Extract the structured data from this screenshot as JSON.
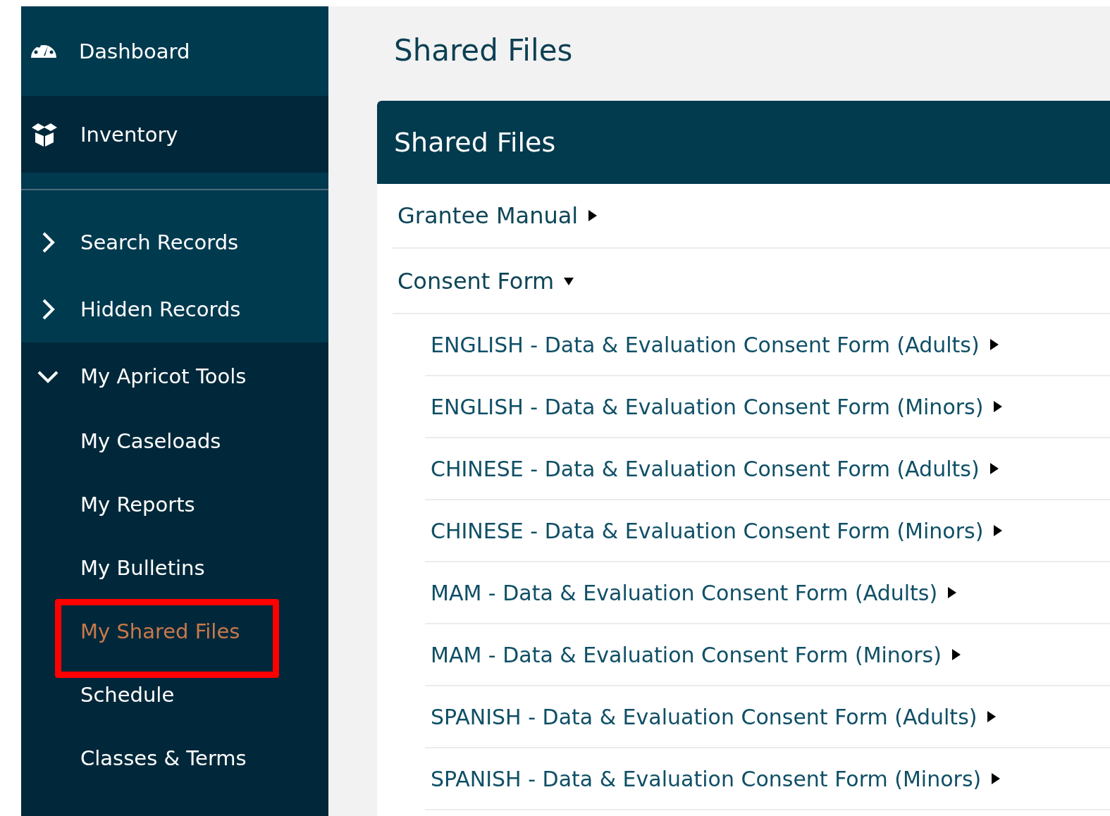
{
  "sidebar": {
    "top_items": [
      {
        "label": "Dashboard",
        "selected": false
      },
      {
        "label": "Inventory",
        "selected": true
      }
    ],
    "groups": [
      {
        "label": "Search Records",
        "expanded": false
      },
      {
        "label": "Hidden Records",
        "expanded": false
      },
      {
        "label": "My Apricot Tools",
        "expanded": true,
        "children": [
          {
            "label": "My Caseloads",
            "selected": false,
            "highlighted": false
          },
          {
            "label": "My Reports",
            "selected": false,
            "highlighted": false
          },
          {
            "label": "My Bulletins",
            "selected": false,
            "highlighted": false
          },
          {
            "label": "My Shared Files",
            "selected": true,
            "highlighted": true
          },
          {
            "label": "Schedule",
            "selected": false,
            "highlighted": false
          },
          {
            "label": "Classes & Terms",
            "selected": false,
            "highlighted": false
          }
        ]
      }
    ]
  },
  "page_title": "Shared Files",
  "panel": {
    "title": "Shared Files",
    "folders": [
      {
        "label": "Grantee Manual",
        "expanded": false
      },
      {
        "label": "Consent Form",
        "expanded": true,
        "files": [
          {
            "label": "ENGLISH - Data & Evaluation Consent Form (Adults)"
          },
          {
            "label": "ENGLISH - Data & Evaluation Consent Form (Minors)"
          },
          {
            "label": "CHINESE - Data & Evaluation Consent Form (Adults)"
          },
          {
            "label": "CHINESE - Data & Evaluation Consent Form (Minors)"
          },
          {
            "label": "MAM - Data & Evaluation Consent Form (Adults)"
          },
          {
            "label": "MAM - Data & Evaluation Consent Form (Minors)"
          },
          {
            "label": "SPANISH - Data & Evaluation Consent Form (Adults)"
          },
          {
            "label": "SPANISH - Data & Evaluation Consent Form (Minors)"
          }
        ]
      }
    ]
  }
}
